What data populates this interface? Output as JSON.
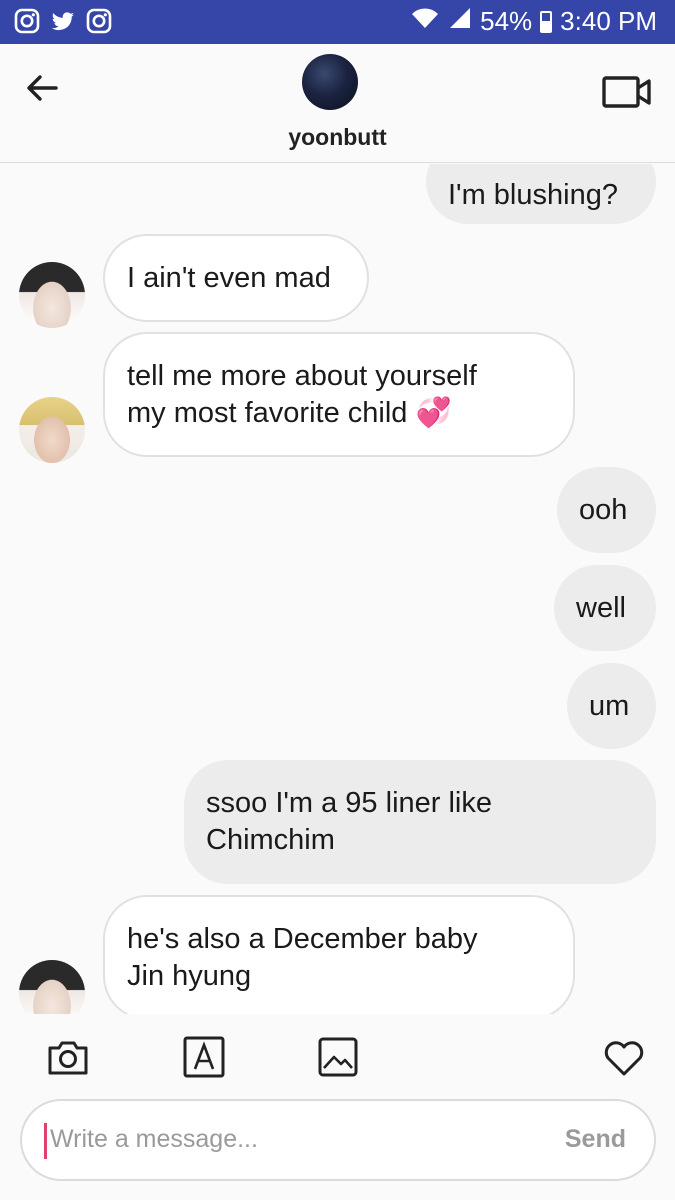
{
  "status_bar": {
    "battery": "54%",
    "time": "3:40 PM",
    "app_icons": [
      "instagram-icon",
      "twitter-icon",
      "instagram-icon"
    ]
  },
  "header": {
    "username": "yoonbutt"
  },
  "messages": [
    {
      "direction": "out",
      "text": "I'm blushing?"
    },
    {
      "direction": "in",
      "text": "I ain't even mad"
    },
    {
      "direction": "in",
      "text": "tell me more about yourself\nmy most favorite child 💞"
    },
    {
      "direction": "out",
      "text": "ooh"
    },
    {
      "direction": "out",
      "text": "well"
    },
    {
      "direction": "out",
      "text": "um"
    },
    {
      "direction": "out",
      "text": "ssoo I'm a 95 liner like\nChimchim"
    },
    {
      "direction": "in",
      "text": "he's also a December baby\nJin hyung"
    }
  ],
  "composer": {
    "placeholder": "Write a message...",
    "send_label": "Send"
  },
  "colors": {
    "status_bar": "#3545a8",
    "caret": "#e0406a"
  }
}
